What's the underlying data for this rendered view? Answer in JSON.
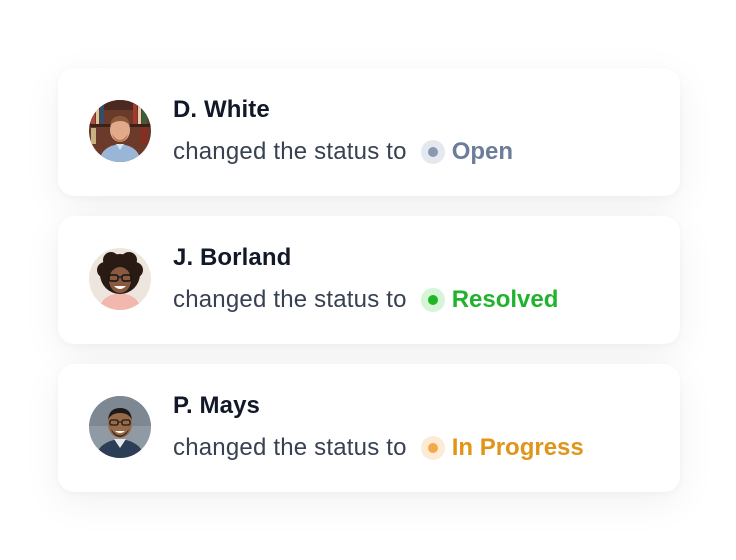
{
  "activity": [
    {
      "name": "D. White",
      "action": "changed the status to",
      "status": "Open",
      "status_color": "#6b7d99",
      "dot_color": "#8a98b1",
      "dot_bg": "#e4e8ef",
      "avatar": "man-with-bookshelf-avatar"
    },
    {
      "name": "J. Borland",
      "action": "changed the status to",
      "status": "Resolved",
      "status_color": "#22b32e",
      "dot_color": "#1fb525",
      "dot_bg": "#d6f5d6",
      "avatar": "woman-with-glasses-avatar"
    },
    {
      "name": "P. Mays",
      "action": "changed the status to",
      "status": "In Progress",
      "status_color": "#e0951a",
      "dot_color": "#f5a84a",
      "dot_bg": "#fdebd5",
      "avatar": "smiling-man-avatar"
    }
  ]
}
